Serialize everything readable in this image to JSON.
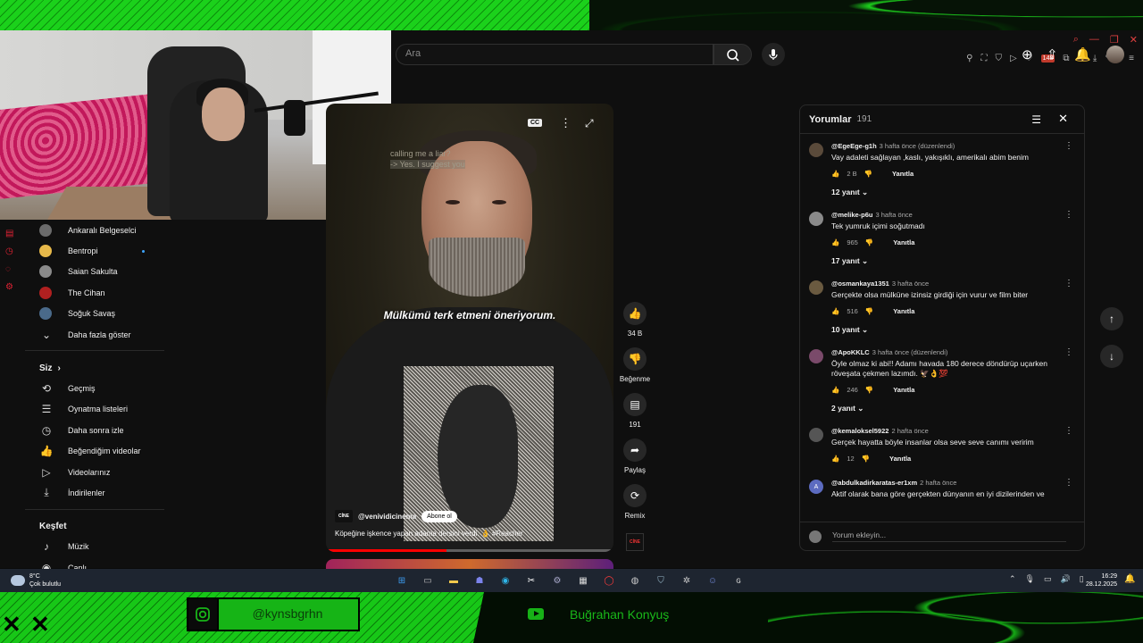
{
  "overlay": {
    "instagram_handle": "@kynsbgrhn",
    "youtube_name": "Buğrahan Konyuş"
  },
  "browser": {
    "extension_badge": "148",
    "ai_label": "AI"
  },
  "search": {
    "placeholder": "Ara"
  },
  "sidebar": {
    "subscriptions": [
      {
        "label": "Ankaralı Belgeselci",
        "color": "#6b6b6b"
      },
      {
        "label": "Bentropi",
        "color": "#e7b94a",
        "live": true
      },
      {
        "label": "Saian Sakulta",
        "color": "#8a8a8a"
      },
      {
        "label": "The Cihan",
        "color": "#b02020"
      },
      {
        "label": "Soğuk Savaş",
        "color": "#4a6a8a"
      }
    ],
    "show_more": "Daha fazla göster",
    "you_heading": "Siz",
    "you_items": [
      {
        "label": "Geçmiş",
        "icon": "history-icon",
        "glyph": "⟲"
      },
      {
        "label": "Oynatma listeleri",
        "icon": "playlists-icon",
        "glyph": "☰"
      },
      {
        "label": "Daha sonra izle",
        "icon": "watch-later-icon",
        "glyph": "◷"
      },
      {
        "label": "Beğendiğim videolar",
        "icon": "thumb-up-icon",
        "glyph": "👍"
      },
      {
        "label": "Videolarınız",
        "icon": "your-videos-icon",
        "glyph": "▷"
      },
      {
        "label": "İndirilenler",
        "icon": "download-icon",
        "glyph": "⤓"
      }
    ],
    "explore_heading": "Keşfet",
    "explore_items": [
      {
        "label": "Müzik",
        "icon": "music-icon",
        "glyph": "♪"
      },
      {
        "label": "Canlı",
        "icon": "live-icon",
        "glyph": "◉"
      }
    ]
  },
  "video": {
    "ghost_caption_1": "calling me a liar?",
    "ghost_caption_2": "-> Yes. I suggest you",
    "cc_label": "CC",
    "subtitle": "Mülkümü terk etmeni öneriyorum.",
    "channel_handle": "@venividicinema",
    "channel_logo_text": "CİNE",
    "subscribe_label": "Abone ol",
    "title": "Köpeğine işkence yapan adama dersini verdi. 👌 #Reacher",
    "progress": 0.42
  },
  "actions": {
    "likes": "34 B",
    "dislike_label": "Beğenme",
    "comments_count": "191",
    "share_label": "Paylaş",
    "remix_label": "Remix"
  },
  "comments": {
    "title": "Yorumlar",
    "count": "191",
    "input_placeholder": "Yorum ekleyin...",
    "reply_label": "Yanıtla",
    "items": [
      {
        "author": "@EgeEge-g1h",
        "time": "3 hafta önce (düzenlendi)",
        "text": "Vay adaleti sağlayan ,kaslı, yakışıklı, amerikalı abim benim",
        "likes": "2 B",
        "replies": "12 yanıt",
        "avatar": "#5a4a3a"
      },
      {
        "author": "@melike-p6u",
        "time": "3 hafta önce",
        "text": "Tek yumruk içimi soğutmadı",
        "likes": "965",
        "replies": "17 yanıt",
        "avatar": "#8a8a8a"
      },
      {
        "author": "@osmankaya1351",
        "time": "3 hafta önce",
        "text": "Gerçekte olsa mülküne izinsiz girdiği için vurur ve film biter",
        "likes": "516",
        "replies": "10 yanıt",
        "avatar": "#6a5a40"
      },
      {
        "author": "@ApoKKLC",
        "time": "3 hafta önce (düzenlendi)",
        "text": "Öyle olmaz ki abi!! Adamı havada 180 derece döndürüp uçarken röveşata çekmen lazımdı. 🦅👌💯",
        "likes": "246",
        "replies": "2 yanıt",
        "avatar": "#7a4a6a"
      },
      {
        "author": "@kemaloksel5922",
        "time": "2 hafta önce",
        "text": "Gerçek hayatta böyle insanlar olsa seve seve canımı veririm",
        "likes": "12",
        "replies": "",
        "avatar": "#555555"
      },
      {
        "author": "@abdulkadirkaratas-er1xm",
        "time": "2 hafta önce",
        "text": "Aktif olarak bana göre gerçekten dünyanın en iyi dizilerinden ve",
        "likes": "",
        "replies": "",
        "avatar": "#5c6bc0",
        "avatar_letter": "A"
      }
    ]
  },
  "taskbar": {
    "temperature": "8°C",
    "weather": "Çok bulutlu",
    "time": "16:29",
    "date": "28.12.2025"
  }
}
